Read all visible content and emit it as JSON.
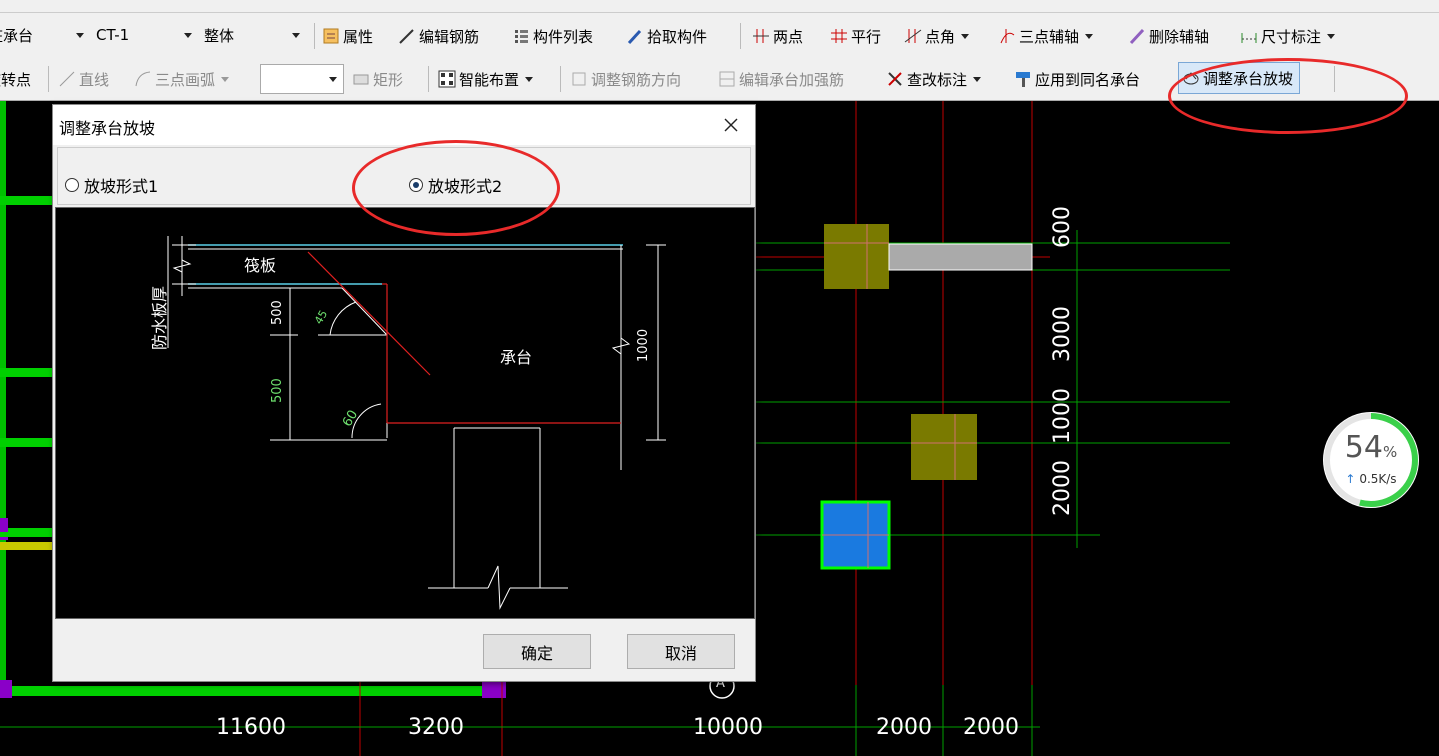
{
  "toolbar_row1": {
    "component_type": "桩承台",
    "component_name": "CT-1",
    "scope": "整体",
    "buttons": [
      "属性",
      "编辑钢筋",
      "构件列表",
      "拾取构件",
      "两点",
      "平行",
      "点角",
      "三点辅轴",
      "删除辅轴",
      "尺寸标注"
    ]
  },
  "toolbar_row2": {
    "buttons": [
      "旋转点",
      "直线",
      "三点画弧",
      "矩形",
      "智能布置",
      "调整钢筋方向",
      "编辑承台加强筋",
      "查改标注",
      "应用到同名承台",
      "调整承台放坡"
    ],
    "empty_combo": ""
  },
  "dialog": {
    "title": "调整承台放坡",
    "option1": "放坡形式1",
    "option2": "放坡形式2",
    "selected": "放坡形式2",
    "ok_label": "确定",
    "cancel_label": "取消",
    "diagram": {
      "label_raft": "筏板",
      "label_waterproof": "防水板厚",
      "label_pile_cap": "承台",
      "dim_500_top": "500",
      "dim_500_bottom": "500",
      "dim_1000": "1000",
      "angle_45": "45",
      "angle_60": "60"
    }
  },
  "canvas": {
    "dims_bottom": [
      "11600",
      "3200",
      "10000",
      "2000",
      "2000"
    ],
    "dims_right": [
      "600",
      "3000",
      "1000",
      "2000"
    ],
    "axis_label": "A"
  },
  "net_widget": {
    "percent": "54",
    "percent_sign": "%",
    "speed": "0.5K/s",
    "progress": 0.54
  },
  "colors": {
    "annotation_ring": "#e82a2a",
    "cad_green": "#00b400",
    "cad_red": "#c00000",
    "cap_olive": "#7a7a00",
    "cap_selected": "#1a7ae0"
  }
}
